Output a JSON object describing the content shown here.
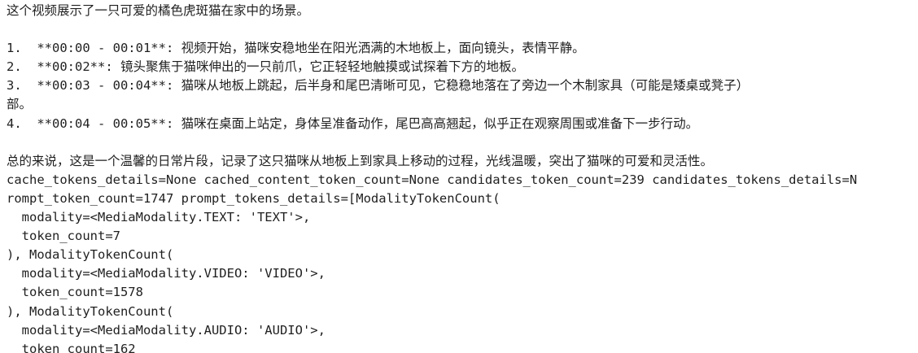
{
  "output": {
    "lines": [
      "这个视频展示了一只可爱的橘色虎斑猫在家中的场景。",
      "",
      "1.  **00:00 - 00:01**: 视频开始，猫咪安稳地坐在阳光洒满的木地板上，面向镜头，表情平静。",
      "2.  **00:02**: 镜头聚焦于猫咪伸出的一只前爪，它正轻轻地触摸或试探着下方的地板。",
      "3.  **00:03 - 00:04**: 猫咪从地板上跳起，后半身和尾巴清晰可见，它稳稳地落在了旁边一个木制家具（可能是矮桌或凳子）",
      "部。",
      "4.  **00:04 - 00:05**: 猫咪在桌面上站定，身体呈准备动作，尾巴高高翘起，似乎正在观察周围或准备下一步行动。",
      "",
      "总的来说，这是一个温馨的日常片段，记录了这只猫咪从地板上到家具上移动的过程，光线温暖，突出了猫咪的可爱和灵活性。",
      "cache_tokens_details=None cached_content_token_count=None candidates_token_count=239 candidates_tokens_details=N",
      "rompt_token_count=1747 prompt_tokens_details=[ModalityTokenCount(",
      "  modality=<MediaModality.TEXT: 'TEXT'>,",
      "  token_count=7",
      "), ModalityTokenCount(",
      "  modality=<MediaModality.VIDEO: 'VIDEO'>,",
      "  token_count=1578",
      "), ModalityTokenCount(",
      "  modality=<MediaModality.AUDIO: 'AUDIO'>,",
      "  token_count=162"
    ]
  }
}
